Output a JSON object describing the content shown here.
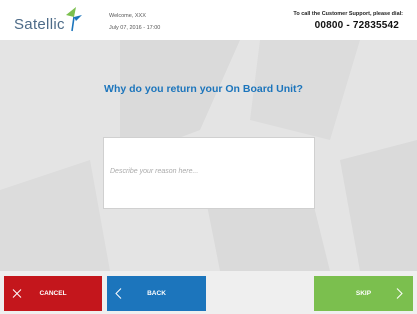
{
  "header": {
    "logo_text": "Satellic",
    "welcome": "Welcome, XXX",
    "datetime": "July 07, 2016 - 17:00",
    "support_label": "To call the Customer Support, please dial:",
    "support_phone": "00800 - 72835542"
  },
  "main": {
    "question": "Why do you return your On Board Unit?",
    "reason_placeholder": "Describe your reason here..."
  },
  "footer": {
    "cancel_label": "CANCEL",
    "back_label": "BACK",
    "skip_label": "SKIP"
  },
  "colors": {
    "cancel": "#c4161c",
    "back": "#1c75bc",
    "skip": "#7bbf4e",
    "accent": "#1c75bc"
  }
}
